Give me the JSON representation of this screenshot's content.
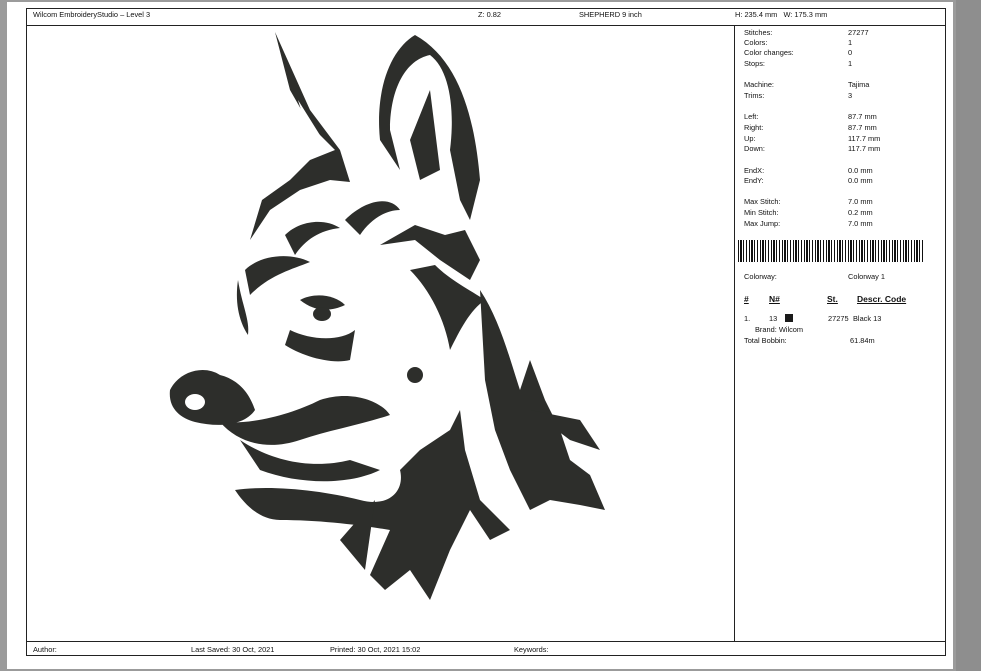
{
  "header": {
    "app_title": "Wilcom EmbroideryStudio – Level 3",
    "zoom": "Z: 0.82",
    "design_name": "SHEPHERD 9 inch",
    "dimensions": "H: 235.4 mm   W: 175.3 mm"
  },
  "stats": {
    "stitches_label": "Stitches:",
    "stitches": "27277",
    "colors_label": "Colors:",
    "colors": "1",
    "color_changes_label": "Color changes:",
    "color_changes": "0",
    "stops_label": "Stops:",
    "stops": "1",
    "machine_label": "Machine:",
    "machine": "Tajima",
    "trims_label": "Trims:",
    "trims": "3",
    "left_label": "Left:",
    "left": "87.7 mm",
    "right_label": "Right:",
    "right": "87.7 mm",
    "up_label": "Up:",
    "up": "117.7 mm",
    "down_label": "Down:",
    "down": "117.7 mm",
    "endx_label": "EndX:",
    "endx": "0.0 mm",
    "endy_label": "EndY:",
    "endy": "0.0 mm",
    "max_stitch_label": "Max Stitch:",
    "max_stitch": "7.0 mm",
    "min_stitch_label": "Min Stitch:",
    "min_stitch": "0.2 mm",
    "max_jump_label": "Max Jump:",
    "max_jump": "7.0 mm"
  },
  "colorway": {
    "label": "Colorway:",
    "value": "Colorway 1",
    "headers": {
      "num": "#",
      "n": "N#",
      "st": "St.",
      "descr": "Descr. Code"
    },
    "row": {
      "num": "1.",
      "n": "13",
      "st": "27275",
      "descr": "Black 13",
      "swatch_color": "#1a1a1a"
    },
    "brand": "Brand: Wilcom",
    "bobbin_label": "Total Bobbin:",
    "bobbin": "61.84m"
  },
  "footer": {
    "author": "Author:",
    "last_saved": "Last Saved: 30 Oct, 2021",
    "printed": "Printed: 30 Oct, 2021 15:02",
    "keywords": "Keywords:"
  }
}
